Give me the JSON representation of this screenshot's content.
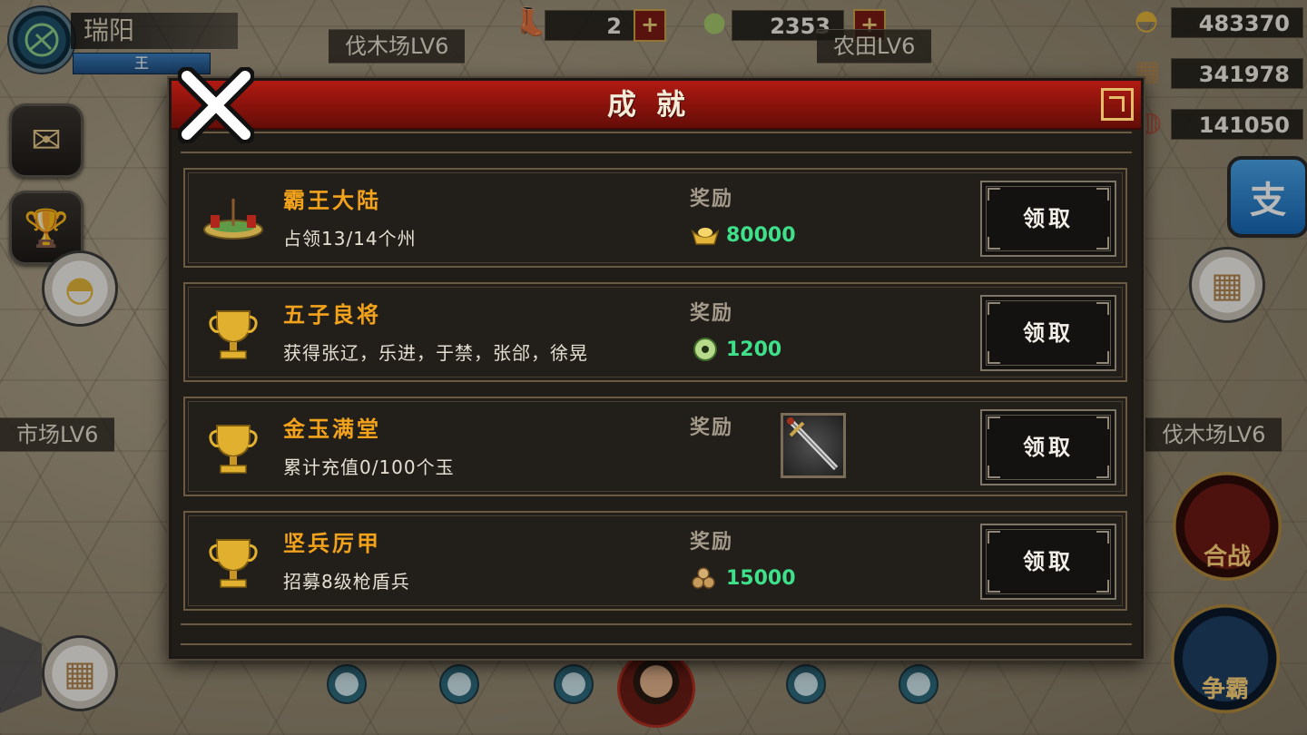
{
  "player": {
    "name": "瑞阳",
    "rank": "王"
  },
  "resources": {
    "boots": "2",
    "jade": "2353",
    "gold": "483370",
    "wood": "341978",
    "meat": "141050"
  },
  "map_labels": {
    "top_left": "伐木场LV6",
    "top_mid": "农田LV6",
    "top_right": "市场LV6",
    "mid_left": "市场LV6",
    "mid_right": "伐木场LV6"
  },
  "buttons": {
    "battle": "合战",
    "dominate": "争霸",
    "pay": "支"
  },
  "dialog": {
    "title": "成就",
    "reward_label": "奖励",
    "claim_label": "领取",
    "achievements": [
      {
        "name": "霸王大陆",
        "desc": "占领13/14个州",
        "reward_icon": "gold-ingot-icon",
        "reward": "80000"
      },
      {
        "name": "五子良将",
        "desc": "获得张辽，乐进，于禁，张郃，徐晃",
        "reward_icon": "jade-icon",
        "reward": "1200"
      },
      {
        "name": "金玉满堂",
        "desc": "累计充值0/100个玉",
        "reward_icon": "sword-item-icon",
        "reward": ""
      },
      {
        "name": "坚兵厉甲",
        "desc": "招募8级枪盾兵",
        "reward_icon": "wood-icon",
        "reward": "15000"
      }
    ]
  },
  "colors": {
    "title_bar": "#9a160e",
    "achievement_name": "#f2a21b",
    "reward_value": "#3fe08a"
  }
}
